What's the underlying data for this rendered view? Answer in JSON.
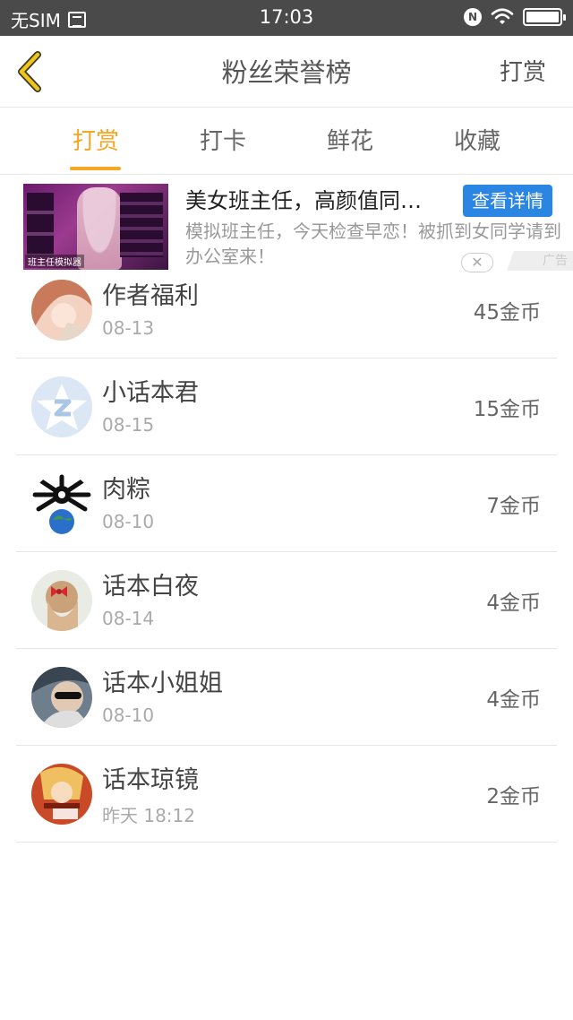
{
  "status_bar": {
    "carrier": "无SIM",
    "time": "17:03",
    "nfc": "N",
    "icons": [
      "sim-icon",
      "nfc-icon",
      "wifi-icon",
      "battery-icon"
    ]
  },
  "header": {
    "title": "粉丝荣誉榜",
    "action_label": "打赏",
    "back_icon": "chevron-left-icon"
  },
  "tabs": [
    {
      "label": "打赏",
      "active": true
    },
    {
      "label": "打卡",
      "active": false
    },
    {
      "label": "鲜花",
      "active": false
    },
    {
      "label": "收藏",
      "active": false
    }
  ],
  "ad": {
    "title": "美女班主任，高颜值同…",
    "cta": "查看详情",
    "description": "模拟班主任，今天检查早恋！被抓到女同学请到办公室来！",
    "image_caption": "班主任模拟器",
    "close": "✕",
    "badge": "广告"
  },
  "list": [
    {
      "name": "作者福利",
      "date": "08-13",
      "amount": "45金币",
      "avatar": "avatar-anime-girl"
    },
    {
      "name": "小话本君",
      "date": "08-15",
      "amount": "15金币",
      "avatar": "avatar-default-z"
    },
    {
      "name": "肉粽",
      "date": "08-10",
      "amount": "7金币",
      "avatar": "avatar-spider-globe"
    },
    {
      "name": "话本白夜",
      "date": "08-14",
      "amount": "4金币",
      "avatar": "avatar-bow-girl"
    },
    {
      "name": "话本小姐姐",
      "date": "08-10",
      "amount": "4金币",
      "avatar": "avatar-sunglasses"
    },
    {
      "name": "话本琼镜",
      "date": "昨天 18:12",
      "amount": "2金币",
      "avatar": "avatar-anime-red"
    }
  ],
  "colors": {
    "accent": "#f5a623",
    "status_bar": "#4a4a4a",
    "ad_cta": "#2b86e3"
  }
}
